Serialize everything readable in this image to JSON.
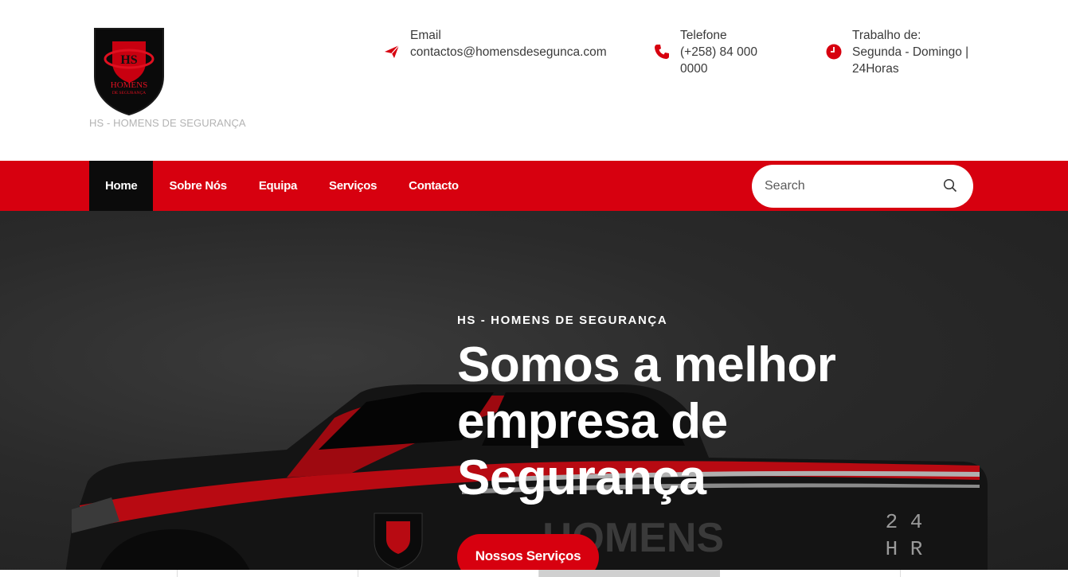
{
  "header": {
    "logo": {
      "emblem_text": "HS",
      "line1": "HOMENS",
      "line2": "DE SEGURANÇA"
    },
    "site_title": "HS - HOMENS DE SEGURANÇA",
    "email": {
      "label": "Email",
      "value": "contactos@homensdesegunca.com",
      "icon": "paper-plane-icon"
    },
    "phone": {
      "label": "Telefone",
      "value": "(+258) 84 000 0000",
      "icon": "phone-icon"
    },
    "hours": {
      "label": "Trabalho de:",
      "value": "Segunda - Domingo | 24Horas",
      "icon": "clock-icon"
    }
  },
  "nav": {
    "items": [
      {
        "label": "Home",
        "active": true
      },
      {
        "label": "Sobre Nós",
        "active": false
      },
      {
        "label": "Equipa",
        "active": false
      },
      {
        "label": "Serviços",
        "active": false
      },
      {
        "label": "Contacto",
        "active": false
      }
    ],
    "search": {
      "placeholder": "Search",
      "value": "",
      "icon": "search-icon"
    }
  },
  "hero": {
    "kicker": "HS - HOMENS DE SEGURANÇA",
    "title": "Somos a melhor empresa de Segurança",
    "button_label": "Nossos Serviços",
    "truck_text": {
      "brand": "HOMENS",
      "badge_line1": "2 4",
      "badge_line2": "H R"
    }
  },
  "colors": {
    "brand_red": "#d7000f",
    "nav_active_bg": "#0b0b0b",
    "hero_bg": "#2a2a2a",
    "muted_text": "#b3b3b3"
  }
}
